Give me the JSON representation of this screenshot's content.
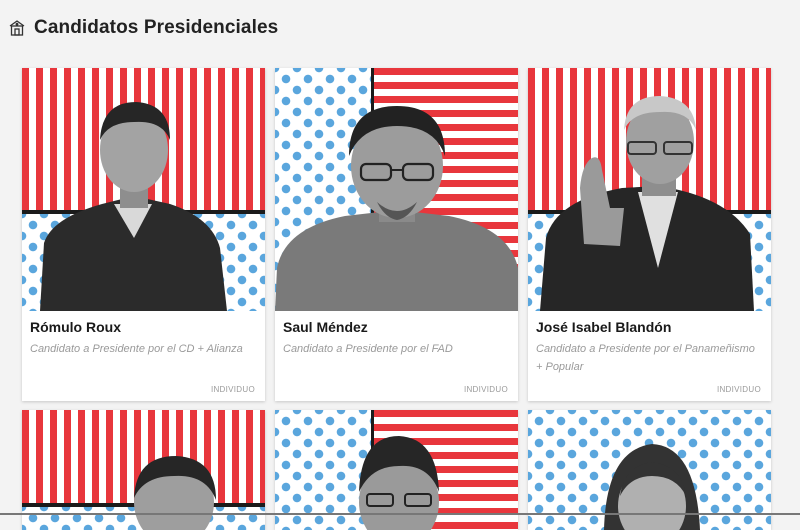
{
  "page": {
    "title": "Candidatos Presidenciales",
    "title_icon": "building-icon"
  },
  "candidates": [
    {
      "name": "Rómulo Roux",
      "description": "Candidato a Presidente por el CD + Alianza",
      "badge": "INDIVIDUO",
      "background": "stripes-over-stars"
    },
    {
      "name": "Saul Méndez",
      "description": "Candidato a Presidente por el FAD",
      "badge": "INDIVIDUO",
      "background": "stars-left-stripes-right"
    },
    {
      "name": "José Isabel Blandón",
      "description": "Candidato a Presidente por el Panameñismo + Popular",
      "badge": "INDIVIDUO",
      "background": "stripes-over-stars"
    },
    {
      "background": "stripes-over-stars"
    },
    {
      "background": "stars-left-stripes-right"
    },
    {
      "background": "stars"
    }
  ],
  "colors": {
    "red": "#e8363c",
    "blue": "#5aa6dd",
    "text": "#1a1a1a",
    "muted": "#9a9a9a"
  }
}
